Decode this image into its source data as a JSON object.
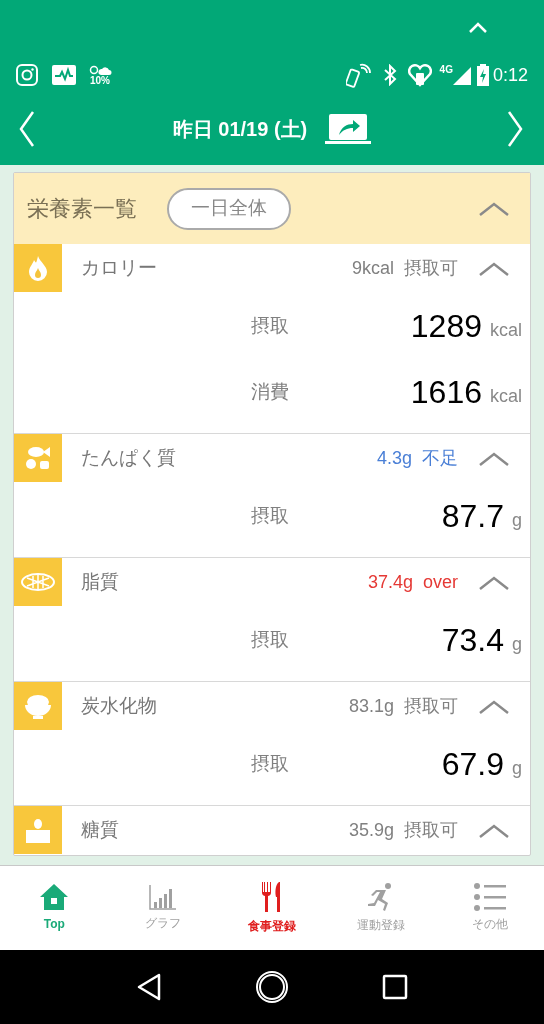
{
  "status_bar": {
    "weather_percent": "10%",
    "network": "4G",
    "time": "0:12"
  },
  "header": {
    "date": "昨日 01/19 (土)"
  },
  "panel": {
    "title": "栄養素一覧",
    "scope_button": "一日全体",
    "expanded": true
  },
  "nutrients": [
    {
      "kind": "flame",
      "name": "カロリー",
      "status": "9kcal  摂取可",
      "color": "#808080",
      "expanded": true,
      "rows": [
        {
          "label": "摂取",
          "value": "1289",
          "unit": "kcal"
        },
        {
          "label": "消費",
          "value": "1616",
          "unit": "kcal"
        }
      ]
    },
    {
      "kind": "protein",
      "name": "たんぱく質",
      "status": "4.3g  不足",
      "color": "#4a7fd6",
      "expanded": true,
      "rows": [
        {
          "label": "摂取",
          "value": "87.7",
          "unit": "g"
        }
      ]
    },
    {
      "kind": "fat",
      "name": "脂質",
      "status": "37.4g  over",
      "color": "#e53935",
      "expanded": true,
      "rows": [
        {
          "label": "摂取",
          "value": "73.4",
          "unit": "g"
        }
      ]
    },
    {
      "kind": "carb",
      "name": "炭水化物",
      "status": "83.1g  摂取可",
      "color": "#808080",
      "expanded": true,
      "rows": [
        {
          "label": "摂取",
          "value": "67.9",
          "unit": "g"
        }
      ]
    },
    {
      "kind": "sugar",
      "name": "糖質",
      "status": "35.9g  摂取可",
      "color": "#808080",
      "expanded": true
    }
  ],
  "tabs": [
    {
      "kind": "home",
      "label": "Top",
      "color": "#1aaa78",
      "selected": true
    },
    {
      "kind": "graph",
      "label": "グラフ",
      "color": "#a0a0a0",
      "selected": false
    },
    {
      "kind": "meal",
      "label": "食事登録",
      "color": "#e01e1e",
      "selected": true
    },
    {
      "kind": "run",
      "label": "運動登録",
      "color": "#a0a0a0",
      "selected": false
    },
    {
      "kind": "menu",
      "label": "その他",
      "color": "#a0a0a0",
      "selected": false
    }
  ]
}
